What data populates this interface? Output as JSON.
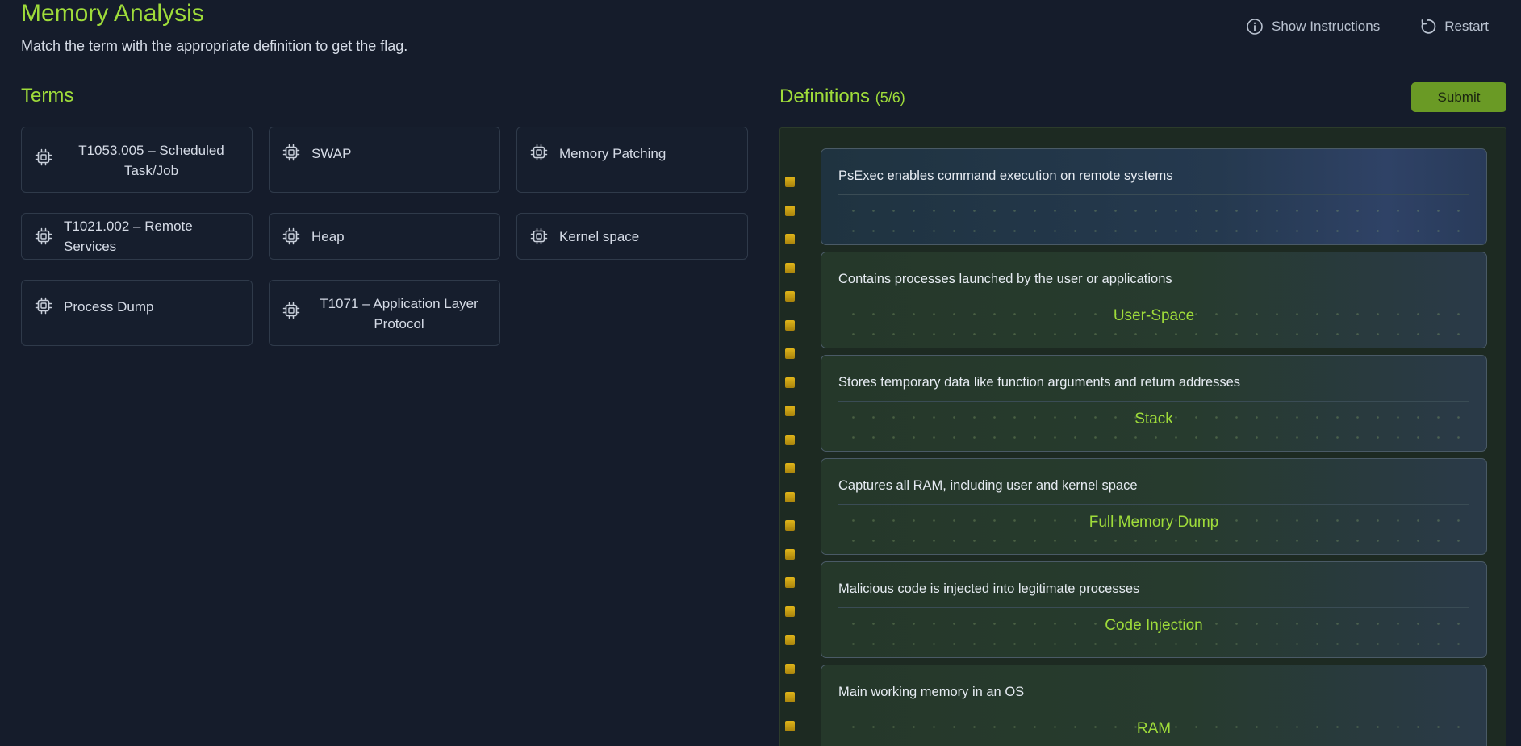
{
  "header": {
    "title": "Memory Analysis",
    "subtitle": "Match the term with the appropriate definition to get the flag.",
    "show_instructions_label": "Show Instructions",
    "restart_label": "Restart"
  },
  "terms": {
    "title": "Terms",
    "items": [
      {
        "label": "T1053.005 – Scheduled Task/Job",
        "icon": "chip-icon"
      },
      {
        "label": "SWAP",
        "icon": "chip-icon"
      },
      {
        "label": "Memory Patching",
        "icon": "chip-icon"
      },
      {
        "label": "T1021.002 – Remote Services",
        "icon": "chip-icon"
      },
      {
        "label": "Heap",
        "icon": "chip-icon"
      },
      {
        "label": "Kernel space",
        "icon": "chip-icon"
      },
      {
        "label": "Process Dump",
        "icon": "chip-icon"
      },
      {
        "label": "T1071 – Application Layer Protocol",
        "icon": "chip-icon"
      }
    ]
  },
  "definitions": {
    "title": "Definitions",
    "count": "(5/6)",
    "submit_label": "Submit",
    "items": [
      {
        "text": "PsExec enables command execution on remote systems",
        "answer": ""
      },
      {
        "text": "Contains processes launched by the user or applications",
        "answer": "User-Space"
      },
      {
        "text": "Stores temporary data like function arguments and return addresses",
        "answer": "Stack"
      },
      {
        "text": "Captures all RAM, including user and kernel space",
        "answer": "Full Memory Dump"
      },
      {
        "text": "Malicious code is injected into legitimate processes",
        "answer": "Code Injection"
      },
      {
        "text": "Main working memory in an OS",
        "answer": "RAM"
      }
    ]
  },
  "colors": {
    "accent": "#9fdc3a",
    "background": "#151c2b",
    "submit": "#6a9a25",
    "pin": "#e0b51a"
  }
}
